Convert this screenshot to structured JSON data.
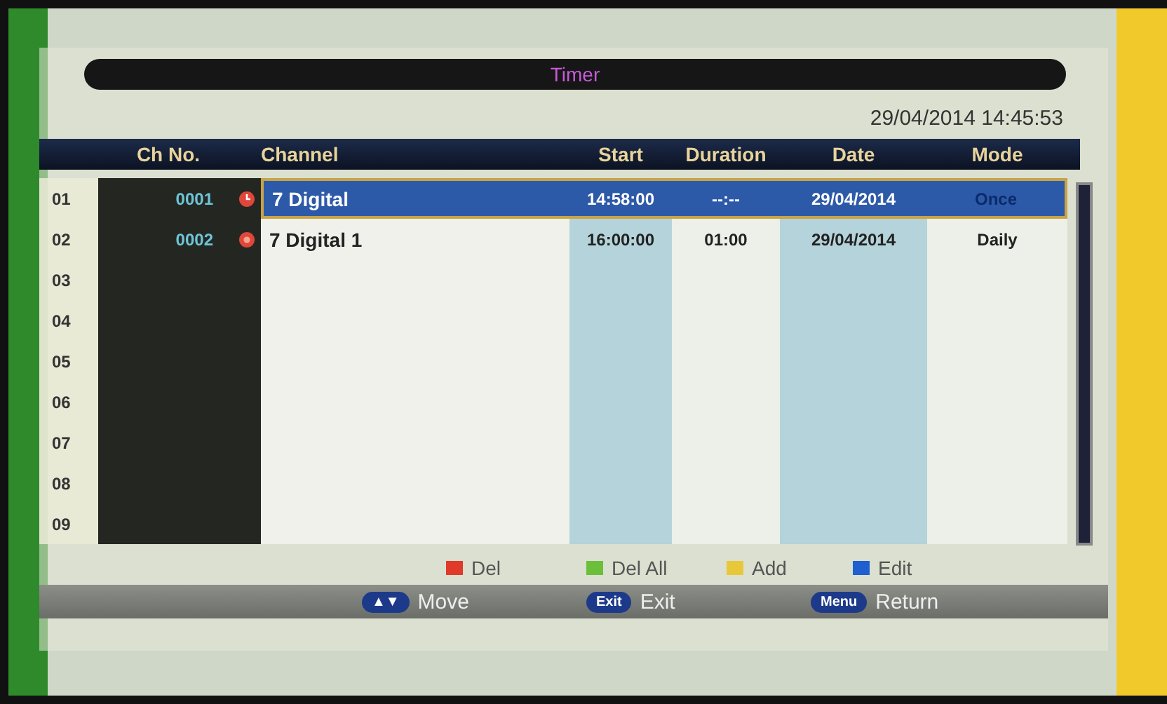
{
  "window": {
    "title": "Timer"
  },
  "clock": "29/04/2014 14:45:53",
  "table": {
    "columns": [
      "Ch No.",
      "Channel",
      "Start",
      "Duration",
      "Date",
      "Mode"
    ],
    "rows": [
      {
        "index": "01",
        "ch_no": "0001",
        "kind": "clock",
        "channel": "7 Digital",
        "start": "14:58:00",
        "duration": "--:--",
        "date": "29/04/2014",
        "mode": "Once",
        "selected": true
      },
      {
        "index": "02",
        "ch_no": "0002",
        "kind": "record",
        "channel": "7 Digital 1",
        "start": "16:00:00",
        "duration": "01:00",
        "date": "29/04/2014",
        "mode": "Daily",
        "selected": false
      },
      {
        "index": "03",
        "selected": false
      },
      {
        "index": "04",
        "selected": false
      },
      {
        "index": "05",
        "selected": false
      },
      {
        "index": "06",
        "selected": false
      },
      {
        "index": "07",
        "selected": false
      },
      {
        "index": "08",
        "selected": false
      },
      {
        "index": "09",
        "selected": false
      }
    ]
  },
  "color_keys": [
    {
      "label": "Del",
      "color": "#e03a2a"
    },
    {
      "label": "Del All",
      "color": "#6cbf3a"
    },
    {
      "label": "Add",
      "color": "#e8c83a"
    },
    {
      "label": "Edit",
      "color": "#1f5fd0"
    }
  ],
  "hints": [
    {
      "key": "▲▼",
      "label": "Move"
    },
    {
      "key": "Exit",
      "label": "Exit"
    },
    {
      "key": "Menu",
      "label": "Return"
    }
  ]
}
